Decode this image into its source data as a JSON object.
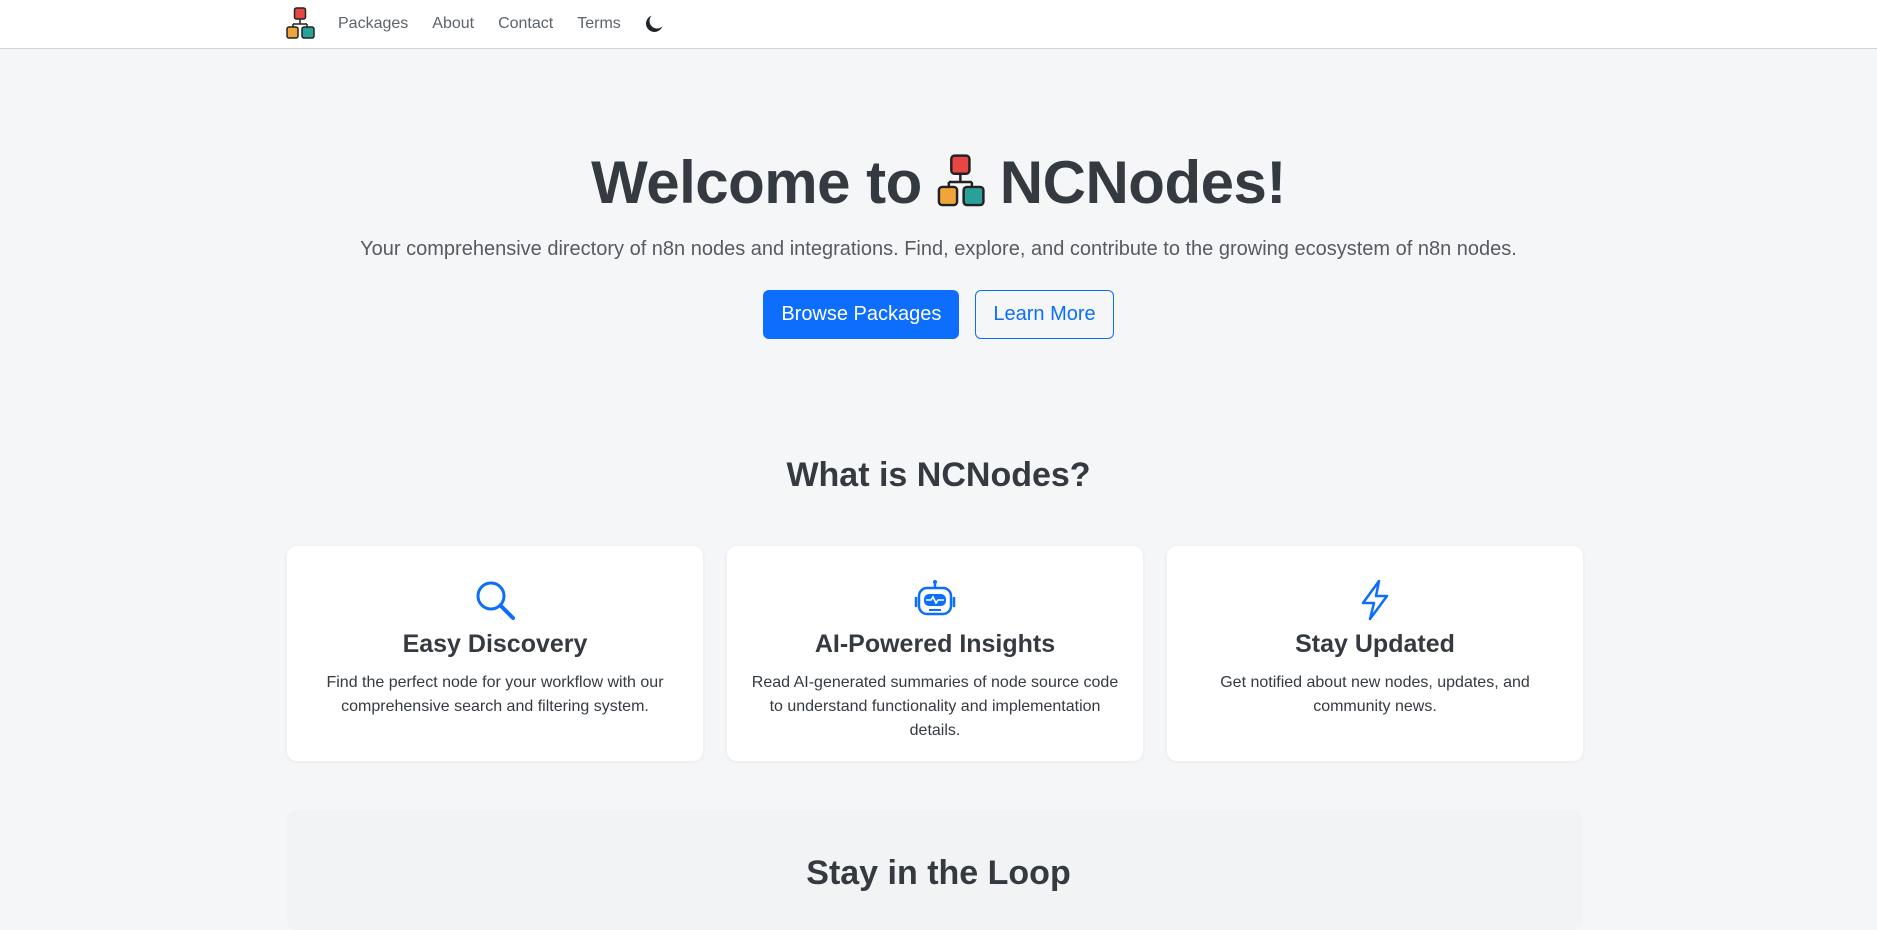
{
  "nav": {
    "links": [
      "Packages",
      "About",
      "Contact",
      "Terms"
    ]
  },
  "hero": {
    "title_before": "Welcome to",
    "title_after": "NCNodes!",
    "subtitle": "Your comprehensive directory of n8n nodes and integrations. Find, explore, and contribute to the growing ecosystem of n8n nodes.",
    "primary_button": "Browse Packages",
    "secondary_button": "Learn More"
  },
  "about": {
    "heading": "What is NCNodes?",
    "cards": [
      {
        "icon": "search-icon",
        "title": "Easy Discovery",
        "text": "Find the perfect node for your workflow with our comprehensive search and filtering system."
      },
      {
        "icon": "robot-icon",
        "title": "AI-Powered Insights",
        "text": "Read AI-generated summaries of node source code to understand functionality and implementation details."
      },
      {
        "icon": "lightning-icon",
        "title": "Stay Updated",
        "text": "Get notified about new nodes, updates, and community news."
      }
    ]
  },
  "newsletter": {
    "heading": "Stay in the Loop"
  },
  "colors": {
    "accent": "#0d6efd",
    "heading": "#343a40",
    "background": "#f5f6f8"
  }
}
